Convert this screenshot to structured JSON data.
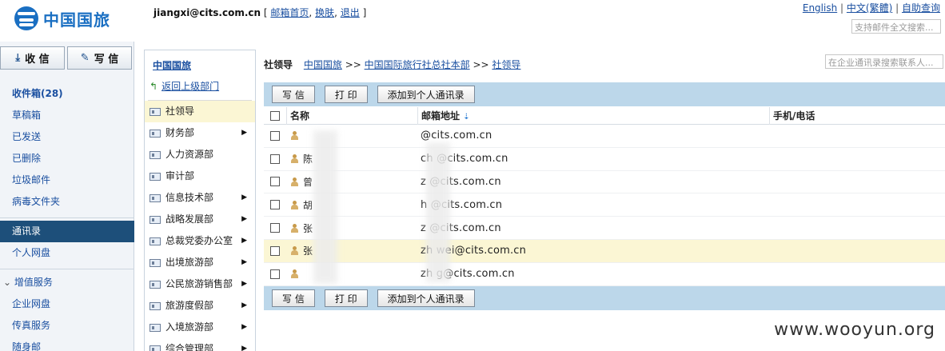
{
  "header": {
    "logo_text": "中国国旅",
    "user_email": "jiangxi@cits.com.cn",
    "bracket_open": "[",
    "bracket_close": "]",
    "sep": ",",
    "links": [
      "邮箱首页",
      "换肤",
      "退出"
    ],
    "top_links": [
      "English",
      "中文(繁體)",
      "自助查询"
    ],
    "top_sep": "|",
    "fulltext_placeholder": "支持邮件全文搜索..."
  },
  "sidebar": {
    "receive_label": "收 信",
    "write_label": "写 信",
    "folders": [
      {
        "label": "收件箱(28)",
        "bold": true
      },
      {
        "label": "草稿箱"
      },
      {
        "label": "已发送"
      },
      {
        "label": "已删除"
      },
      {
        "label": "垃圾邮件"
      },
      {
        "label": "病毒文件夹"
      }
    ],
    "contacts_label": "通讯录",
    "netdisk_label": "个人网盘",
    "value_added_label": "增值服务",
    "services": [
      "企业网盘",
      "传真服务",
      "随身邮"
    ]
  },
  "dept": {
    "title": "中国国旅",
    "back_label": "返回上级部门",
    "items": [
      {
        "label": "社领导",
        "has_children": false
      },
      {
        "label": "财务部",
        "has_children": true
      },
      {
        "label": "人力资源部",
        "has_children": false
      },
      {
        "label": "审计部",
        "has_children": false
      },
      {
        "label": "信息技术部",
        "has_children": true
      },
      {
        "label": "战略发展部",
        "has_children": true
      },
      {
        "label": "总裁党委办公室",
        "has_children": true
      },
      {
        "label": "出境旅游部",
        "has_children": true
      },
      {
        "label": "公民旅游销售部",
        "has_children": true
      },
      {
        "label": "旅游度假部",
        "has_children": true
      },
      {
        "label": "入境旅游部",
        "has_children": true
      },
      {
        "label": "综合管理部",
        "has_children": true
      }
    ]
  },
  "main": {
    "crumb_head": "社领导",
    "crumb_sep": ">>",
    "crumbs": [
      "中国国旅",
      "中国国际旅行社总社本部",
      "社领导"
    ],
    "search_placeholder": "在企业通讯录搜索联系人...",
    "toolbar": {
      "write": "写 信",
      "print": "打 印",
      "add": "添加到个人通讯录"
    },
    "columns": {
      "name": "名称",
      "mail": "邮箱地址",
      "phone": "手机/电话"
    },
    "rows": [
      {
        "name": "",
        "mail": "@cits.com.cn",
        "phone": ""
      },
      {
        "name": "陈",
        "mail": "ch    @cits.com.cn",
        "phone": ""
      },
      {
        "name": "曾",
        "mail": "z     @cits.com.cn",
        "phone": ""
      },
      {
        "name": "胡",
        "mail": "h     @cits.com.cn",
        "phone": ""
      },
      {
        "name": "张",
        "mail": "z     @cits.com.cn",
        "phone": ""
      },
      {
        "name": "张",
        "mail": "zh    wei@cits.com.cn",
        "phone": ""
      },
      {
        "name": "",
        "mail": "zh    g@cits.com.cn",
        "phone": ""
      }
    ]
  },
  "watermark": "www.wooyun.org"
}
